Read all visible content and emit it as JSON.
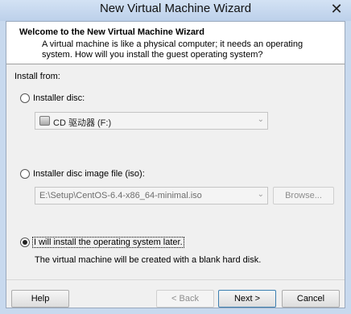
{
  "window": {
    "title": "New Virtual Machine Wizard",
    "close_glyph": "✕"
  },
  "header": {
    "title": "Welcome to the New Virtual Machine Wizard",
    "description": "A virtual machine is like a physical computer; it needs an operating system. How will you install the guest operating system?"
  },
  "install_from": {
    "label": "Install from:",
    "options": [
      {
        "label": "Installer disc:",
        "selected": false
      },
      {
        "label": "Installer disc image file (iso):",
        "selected": false
      },
      {
        "label": "I will install the operating system later.",
        "selected": true
      }
    ],
    "disc_select_value": "CD 驱动器 (F:)",
    "iso_select_value": "E:\\Setup\\CentOS-6.4-x86_64-minimal.iso",
    "browse_label": "Browse...",
    "later_description": "The virtual machine will be created with a blank hard disk."
  },
  "footer": {
    "help_label": "Help",
    "back_label": "< Back",
    "next_label": "Next >",
    "cancel_label": "Cancel"
  },
  "icons": {
    "disc_drive": "disc-drive-icon",
    "dropdown": "chevron-down-icon"
  }
}
